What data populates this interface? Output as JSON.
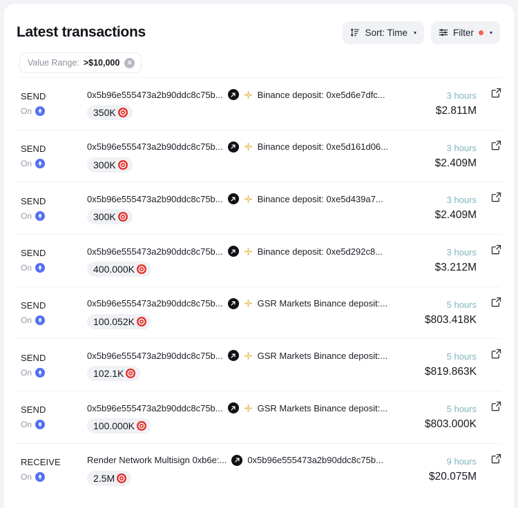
{
  "header": {
    "title": "Latest transactions",
    "sort_button": {
      "label": "Sort: Time",
      "icon": "sort-icon",
      "caret": "▾"
    },
    "filter_button": {
      "label": "Filter",
      "icon": "filter-sliders-icon",
      "caret": "▾",
      "indicator_color": "#f4614f"
    }
  },
  "active_filters": [
    {
      "key": "Value Range:",
      "value": ">$10,000",
      "remove_label": "✕"
    }
  ],
  "colors": {
    "page_background": "#f2f3f7",
    "card_background": "#ffffff",
    "row_divider": "#eef0f3",
    "time_text": "#7fb4bd",
    "filter_dot": "#f4614f",
    "token_red": "#e3302b",
    "ethereum_blue": "#5470f0",
    "binance_gold": "#e3b341",
    "direction_black": "#101114",
    "pill_background": "#f0f1f5"
  },
  "transactions": [
    {
      "direction": "SEND",
      "chain_prefix": "On",
      "chain_icon": "ethereum-icon",
      "from": "0x5b96e555473a2b90ddc8c75b...",
      "direction_icon": "arrow-out-icon",
      "to_icon": "binance-icon",
      "to": "Binance deposit: 0xe5d6e7dfc...",
      "amount": "350K",
      "token_icon": "render-token-icon",
      "time": "3 hours",
      "usd": "$2.811M",
      "external_link_icon": "external-link-icon"
    },
    {
      "direction": "SEND",
      "chain_prefix": "On",
      "chain_icon": "ethereum-icon",
      "from": "0x5b96e555473a2b90ddc8c75b...",
      "direction_icon": "arrow-out-icon",
      "to_icon": "binance-icon",
      "to": "Binance deposit: 0xe5d161d06...",
      "amount": "300K",
      "token_icon": "render-token-icon",
      "time": "3 hours",
      "usd": "$2.409M",
      "external_link_icon": "external-link-icon"
    },
    {
      "direction": "SEND",
      "chain_prefix": "On",
      "chain_icon": "ethereum-icon",
      "from": "0x5b96e555473a2b90ddc8c75b...",
      "direction_icon": "arrow-out-icon",
      "to_icon": "binance-icon",
      "to": "Binance deposit: 0xe5d439a7...",
      "amount": "300K",
      "token_icon": "render-token-icon",
      "time": "3 hours",
      "usd": "$2.409M",
      "external_link_icon": "external-link-icon"
    },
    {
      "direction": "SEND",
      "chain_prefix": "On",
      "chain_icon": "ethereum-icon",
      "from": "0x5b96e555473a2b90ddc8c75b...",
      "direction_icon": "arrow-out-icon",
      "to_icon": "binance-icon",
      "to": "Binance deposit: 0xe5d292c8...",
      "amount": "400.000K",
      "token_icon": "render-token-icon",
      "time": "3 hours",
      "usd": "$3.212M",
      "external_link_icon": "external-link-icon"
    },
    {
      "direction": "SEND",
      "chain_prefix": "On",
      "chain_icon": "ethereum-icon",
      "from": "0x5b96e555473a2b90ddc8c75b...",
      "direction_icon": "arrow-out-icon",
      "to_icon": "binance-icon",
      "to": "GSR Markets Binance deposit:...",
      "amount": "100.052K",
      "token_icon": "render-token-icon",
      "time": "5 hours",
      "usd": "$803.418K",
      "external_link_icon": "external-link-icon"
    },
    {
      "direction": "SEND",
      "chain_prefix": "On",
      "chain_icon": "ethereum-icon",
      "from": "0x5b96e555473a2b90ddc8c75b...",
      "direction_icon": "arrow-out-icon",
      "to_icon": "binance-icon",
      "to": "GSR Markets Binance deposit:...",
      "amount": "102.1K",
      "token_icon": "render-token-icon",
      "time": "5 hours",
      "usd": "$819.863K",
      "external_link_icon": "external-link-icon"
    },
    {
      "direction": "SEND",
      "chain_prefix": "On",
      "chain_icon": "ethereum-icon",
      "from": "0x5b96e555473a2b90ddc8c75b...",
      "direction_icon": "arrow-out-icon",
      "to_icon": "binance-icon",
      "to": "GSR Markets Binance deposit:...",
      "amount": "100.000K",
      "token_icon": "render-token-icon",
      "time": "5 hours",
      "usd": "$803.000K",
      "external_link_icon": "external-link-icon"
    },
    {
      "direction": "RECEIVE",
      "chain_prefix": "On",
      "chain_icon": "ethereum-icon",
      "from": "Render Network Multisign 0xb6e:...",
      "direction_icon": "arrow-out-icon",
      "to_icon": null,
      "to": "0x5b96e555473a2b90ddc8c75b...",
      "amount": "2.5M",
      "token_icon": "render-token-icon",
      "time": "9 hours",
      "usd": "$20.075M",
      "external_link_icon": "external-link-icon"
    }
  ]
}
